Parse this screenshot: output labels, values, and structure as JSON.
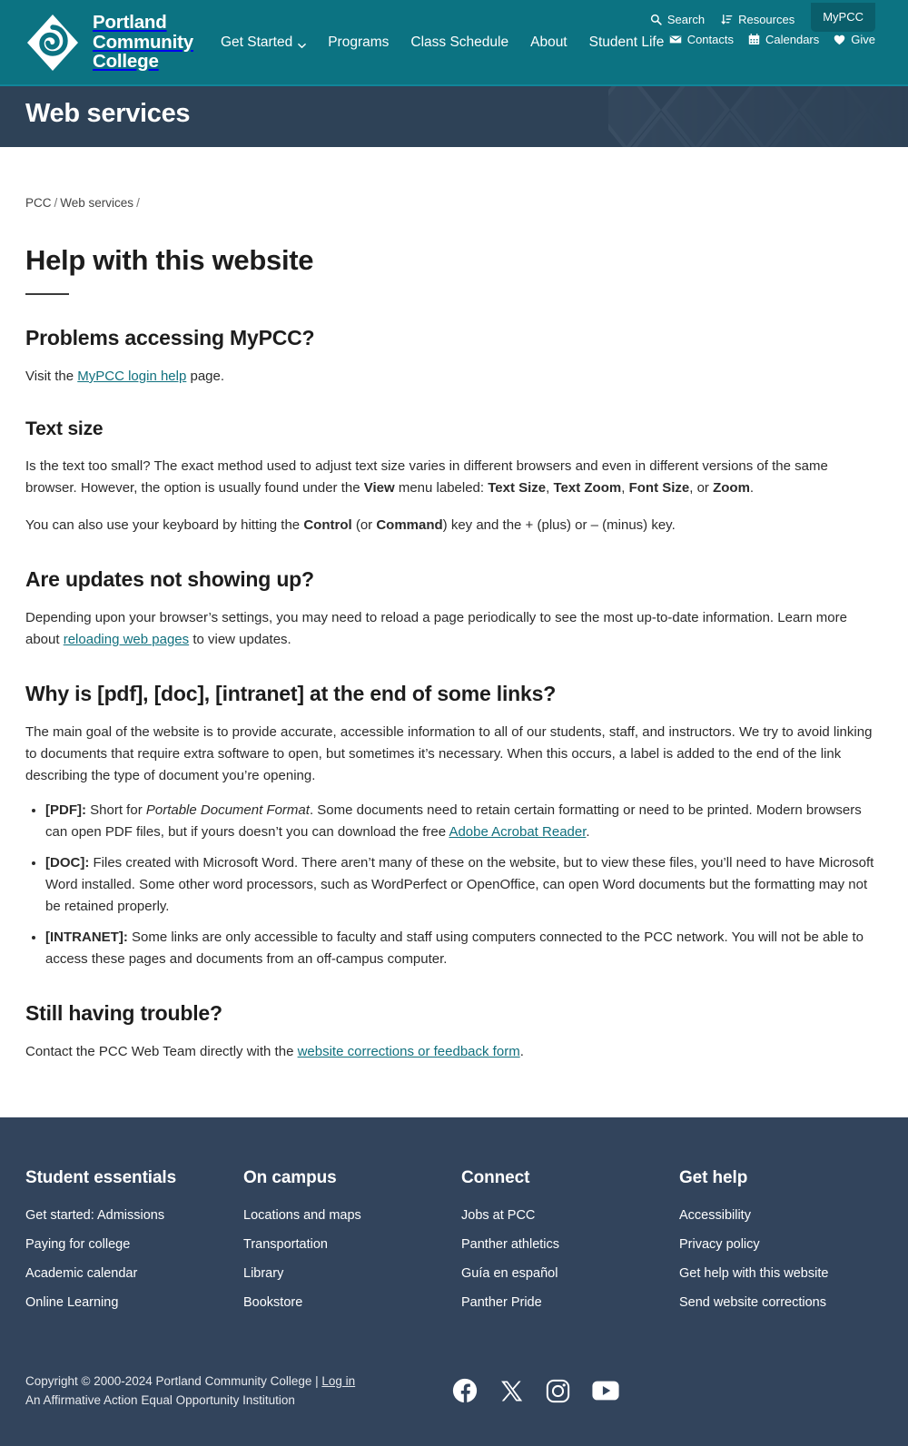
{
  "header": {
    "brand_name": "Portland\nCommunity\nCollege",
    "logo_icon": "pcc-diamond-spiral-logo",
    "nav": [
      {
        "label": "Get Started",
        "has_caret": true,
        "icon": "chevron-down-icon"
      },
      {
        "label": "Programs",
        "has_caret": false
      },
      {
        "label": "Class Schedule",
        "has_caret": false
      },
      {
        "label": "About",
        "has_caret": false
      },
      {
        "label": "Student Life",
        "has_caret": false
      }
    ],
    "utility_row1": [
      {
        "label": "Search",
        "icon": "search-icon"
      },
      {
        "label": "Resources",
        "icon": "sort-arrows-icon"
      }
    ],
    "mypcc_label": "MyPCC",
    "utility_row2": [
      {
        "label": "Contacts",
        "icon": "envelope-icon"
      },
      {
        "label": "Calendars",
        "icon": "calendar-icon"
      },
      {
        "label": "Give",
        "icon": "heart-icon"
      }
    ]
  },
  "banner": {
    "title": "Web services"
  },
  "breadcrumb": {
    "items": [
      "PCC",
      "Web services"
    ],
    "separator": "/"
  },
  "page": {
    "title": "Help with this website"
  },
  "sections": [
    {
      "heading": "Problems accessing MyPCC?",
      "p1_before": "Visit the ",
      "p1_link": "MyPCC login help",
      "p1_after": " page."
    },
    {
      "heading": "Text size",
      "p1_a": "Is the text too small? The exact method used to adjust text size varies in different browsers and even in different versions of the same browser. However, the option is usually found under the ",
      "p1_b": "View",
      "p1_c": " menu labeled: ",
      "p1_d": "Text Size",
      "p1_e": ", ",
      "p1_f": "Text Zoom",
      "p1_g": ", ",
      "p1_h": "Font Size",
      "p1_i": ", or ",
      "p1_j": "Zoom",
      "p1_k": ".",
      "p2_a": "You can also use your keyboard by hitting the ",
      "p2_b": "Control",
      "p2_c": " (or ",
      "p2_d": "Command",
      "p2_e": ") key and the + (plus) or – (minus) key."
    },
    {
      "heading": "Are updates not showing up?",
      "p1_before": "Depending upon your browser’s settings, you may need to reload a page periodically to see the most up-to-date information. Learn more about ",
      "p1_link": "reloading web pages",
      "p1_after": " to view updates."
    },
    {
      "heading": "Why is [pdf], [doc], [intranet] at the end of some links?",
      "p1": "The main goal of the website is to provide accurate, accessible information to all of our students, staff, and instructors. We try to avoid linking to documents that require extra software to open, but sometimes it’s necessary. When this occurs, a label is added to the end of the link describing the type of document you’re opening.",
      "bullets": [
        {
          "label": "[PDF]:",
          "a": " Short for ",
          "italic": "Portable Document Format",
          "b": ". Some documents need to retain certain formatting or need to be printed. Modern browsers can open PDF files, but if yours doesn’t you can download the free ",
          "link": "Adobe Acrobat Reader",
          "c": "."
        },
        {
          "label": "[DOC]:",
          "a": " Files created with Microsoft Word. There aren’t many of these on the website, but to view these files, you’ll need to have Microsoft Word installed. Some other word processors, such as WordPerfect or OpenOffice, can open Word documents but the formatting may not be retained properly.",
          "italic": "",
          "b": "",
          "link": "",
          "c": ""
        },
        {
          "label": "[INTRANET]:",
          "a": " Some links are only accessible to faculty and staff using computers connected to the PCC network. You will not be able to access these pages and documents from an off-campus computer.",
          "italic": "",
          "b": "",
          "link": "",
          "c": ""
        }
      ]
    },
    {
      "heading": "Still having trouble?",
      "p1_before": "Contact the PCC Web Team directly with the ",
      "p1_link": "website corrections or feedback form",
      "p1_after": "."
    }
  ],
  "footer": {
    "columns": [
      {
        "title": "Student essentials",
        "links": [
          "Get started: Admissions",
          "Paying for college",
          "Academic calendar",
          "Online Learning"
        ]
      },
      {
        "title": "On campus",
        "links": [
          "Locations and maps",
          "Transportation",
          "Library",
          "Bookstore"
        ]
      },
      {
        "title": "Connect",
        "links": [
          "Jobs at PCC",
          "Panther athletics",
          "Guía en español",
          "Panther Pride"
        ]
      },
      {
        "title": "Get help",
        "links": [
          "Accessibility",
          "Privacy policy",
          "Get help with this website",
          "Send website corrections"
        ]
      }
    ],
    "copyright_line1_before": "Copyright © 2000-2024 Portland Community College | ",
    "copyright_login": "Log in",
    "copyright_line2": "An Affirmative Action Equal Opportunity Institution",
    "socials": [
      {
        "name": "facebook-icon"
      },
      {
        "name": "x-twitter-icon"
      },
      {
        "name": "instagram-icon"
      },
      {
        "name": "youtube-icon"
      }
    ]
  },
  "colors": {
    "header_teal": "#0c7382",
    "mypcc_dark_teal": "#0a5e6b",
    "banner_slate": "#2e4257",
    "footer_slate": "#32445c",
    "link_teal": "#10707e",
    "text_dark": "#2b2b2b"
  }
}
